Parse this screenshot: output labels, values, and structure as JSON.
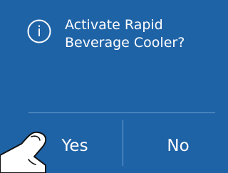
{
  "dialog": {
    "icon": "info-icon",
    "icon_glyph": "i",
    "message": "Activate Rapid Beverage Cooler?"
  },
  "actions": {
    "yes_label": "Yes",
    "no_label": "No"
  },
  "overlay": {
    "icon": "finger-tap-hand-icon"
  },
  "colors": {
    "background": "#1f63a7",
    "text": "#ffffff",
    "divider": "#6c9fd0"
  }
}
